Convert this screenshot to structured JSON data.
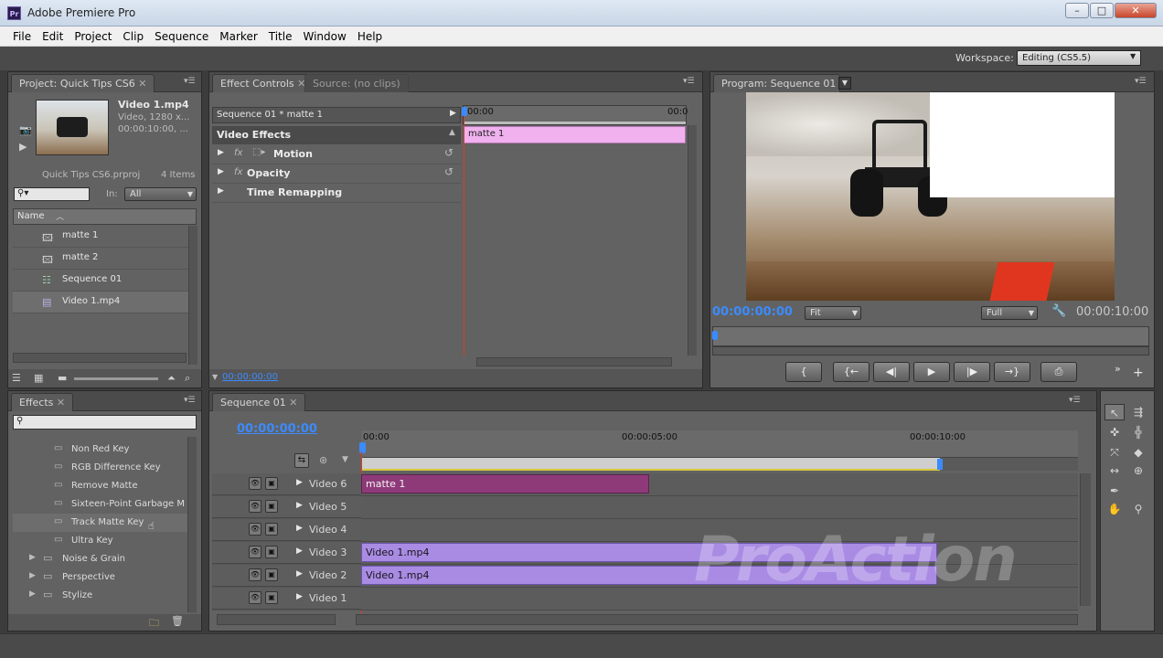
{
  "window": {
    "title": "Adobe Premiere Pro",
    "app_icon": "Pr",
    "controls": [
      "–",
      "□",
      "✕"
    ]
  },
  "menu": [
    "File",
    "Edit",
    "Project",
    "Clip",
    "Sequence",
    "Marker",
    "Title",
    "Window",
    "Help"
  ],
  "workspace": {
    "label": "Workspace:",
    "value": "Editing (CS5.5)"
  },
  "project": {
    "tab": "Project: Quick Tips CS6",
    "preview": {
      "name": "Video 1.mp4",
      "line1": "Video, 1280 x...",
      "line2": "00:00:10:00, ..."
    },
    "file": "Quick Tips CS6.prproj",
    "count": "4 Items",
    "search_placeholder": "",
    "in_label": "In:",
    "in_value": "All",
    "column": "Name",
    "items": [
      {
        "name": "matte 1",
        "icon": "still-image-icon"
      },
      {
        "name": "matte 2",
        "icon": "still-image-icon"
      },
      {
        "name": "Sequence 01",
        "icon": "sequence-icon"
      },
      {
        "name": "Video 1.mp4",
        "icon": "film-icon"
      }
    ]
  },
  "effect_controls": {
    "tab": "Effect Controls",
    "tab2": "Source: (no clips)",
    "sequence": "Sequence 01 * matte 1",
    "ruler_start": "00:00",
    "ruler_end": "00:0",
    "clip": "matte 1",
    "section": "Video Effects",
    "effects": [
      "Motion",
      "Opacity",
      "Time Remapping"
    ],
    "timecode": "00:00:00:00"
  },
  "program": {
    "tab": "Program: Sequence 01",
    "timecode": "00:00:00:00",
    "fit": "Fit",
    "quality": "Full",
    "duration": "00:00:10:00"
  },
  "effects": {
    "tab": "Effects",
    "items": [
      "Non Red Key",
      "RGB Difference Key",
      "Remove Matte",
      "Sixteen-Point Garbage M",
      "Track Matte Key",
      "Ultra Key"
    ],
    "folders": [
      "Noise & Grain",
      "Perspective",
      "Stylize"
    ]
  },
  "timeline": {
    "tab": "Sequence 01",
    "timecode": "00:00:00:00",
    "ruler": [
      "00:00",
      "00:00:05:00",
      "00:00:10:00"
    ],
    "tracks": [
      "Video 6",
      "Video 5",
      "Video 4",
      "Video 3",
      "Video 2",
      "Video 1"
    ],
    "clips": [
      {
        "track": "Video 6",
        "label": "matte 1"
      },
      {
        "track": "Video 3",
        "label": "Video 1.mp4"
      },
      {
        "track": "Video 2",
        "label": "Video 1.mp4"
      }
    ]
  },
  "watermark": "ProAction",
  "colors": {
    "accent_blue": "#3b8bff",
    "playhead": "#e0392b",
    "matte_clip": "#8e3a79",
    "video_clip": "#a98be4",
    "effect_clip": "#f0b1ee"
  }
}
